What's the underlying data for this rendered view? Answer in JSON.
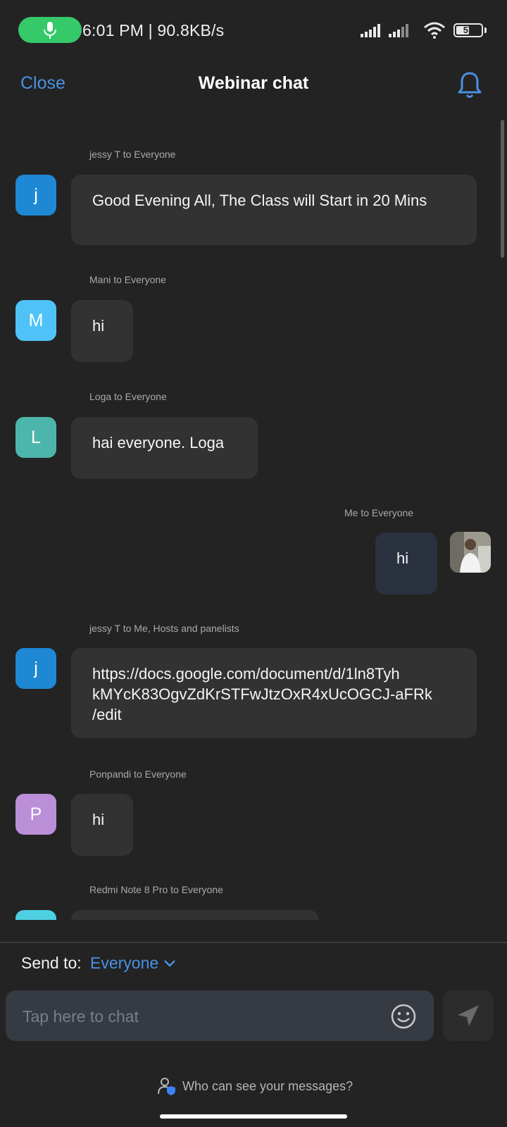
{
  "status_bar": {
    "time_speed": "6:01 PM | 90.8KB/s",
    "battery_level": 57,
    "battery_label": "57"
  },
  "header": {
    "close_label": "Close",
    "title": "Webinar chat",
    "notification_icon": "bell-icon"
  },
  "messages": [
    {
      "sender": "jessy T to Everyone",
      "avatar_letter": "j",
      "avatar_color": "#1e88d4",
      "text": "Good Evening All, The Class will Start in 20 Mins"
    },
    {
      "sender": "Mani to Everyone",
      "avatar_letter": "M",
      "avatar_color": "#4fc3f7",
      "text": "hi"
    },
    {
      "sender": "Loga to Everyone",
      "avatar_letter": "L",
      "avatar_color": "#4db6ac",
      "text": "hai everyone. Loga"
    },
    {
      "sender": "Me to Everyone",
      "avatar": "user-photo",
      "text": "hi",
      "own": true
    },
    {
      "sender": "jessy T to Me, Hosts and panelists",
      "avatar_letter": "j",
      "avatar_color": "#1e88d4",
      "text": "https://docs.google.com/document/d/1ln8TyhkMYcK83OgvZdKrSTFwJtzOxR4xUcOGCJ-aFRk/edit",
      "text_lines": [
        "https://docs.google.com/document/d/1ln8Tyh",
        "kMYcK83OgvZdKrSTFwJtzOxR4xUcOGCJ-aFRk",
        "/edit"
      ]
    },
    {
      "sender": "Ponpandi to Everyone",
      "avatar_letter": "P",
      "avatar_color": "#ba8fd8",
      "text": "hi"
    },
    {
      "sender": "Redmi Note 8 Pro to Everyone",
      "avatar_color": "#4dd0e1"
    }
  ],
  "footer": {
    "send_to_label": "Send to:",
    "send_to_value": "Everyone",
    "input_placeholder": "Tap here to chat",
    "privacy_text": "Who can see your messages?"
  },
  "colors": {
    "accent": "#4a90e2",
    "background": "#232323",
    "bubble": "#323232",
    "own_bubble": "#2a3240"
  }
}
